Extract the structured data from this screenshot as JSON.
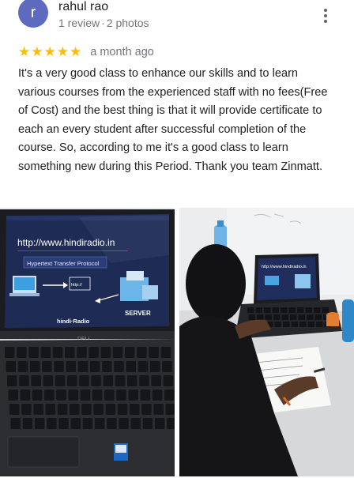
{
  "reviewer": {
    "initial": "r",
    "name": "rahul rao",
    "review_count": "1 review",
    "photo_count": "2 photos",
    "avatar_color": "#5c6bc0"
  },
  "review": {
    "stars": 5,
    "star_color": "#fbbc04",
    "time": "a month ago",
    "text": "It's a very good class to enhance our skills and to learn various courses from the experienced staff with no fees(Free of Cost) and the best thing is that it will provide certificate to each an every student after successful completion of the course. So, according to me it's a good class to learn something new during this Period. Thank you team Zinmatt."
  },
  "photos": [
    {
      "subject": "laptop-screen",
      "screen": {
        "url": "http://www.hindiradio.in",
        "subtitle": "Hypertext Transfer Protocol",
        "server_label": "SERVER",
        "brand": "hindi·Radio",
        "request_label": "http://",
        "laptop_brand": "DELL"
      }
    },
    {
      "subject": "student-at-laptop",
      "screen": {
        "url": "http://www.hindiradio.in"
      }
    }
  ]
}
